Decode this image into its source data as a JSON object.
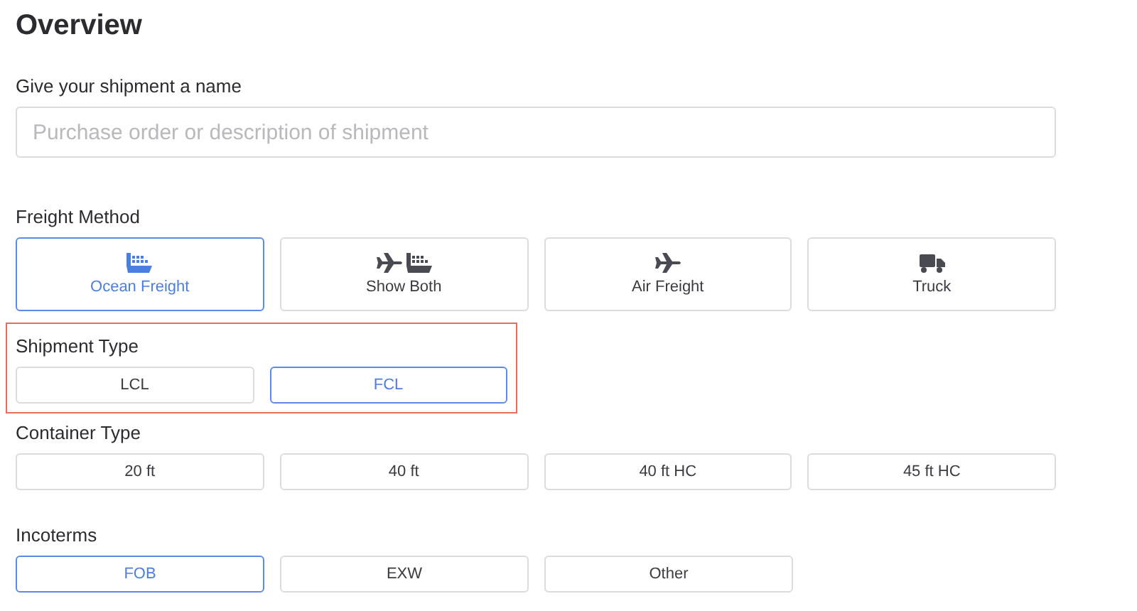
{
  "title": "Overview",
  "name_field": {
    "label": "Give your shipment a name",
    "placeholder": "Purchase order or description of shipment"
  },
  "freight_method": {
    "label": "Freight Method",
    "options": [
      {
        "label": "Ocean Freight",
        "kind": "ship",
        "selected": true
      },
      {
        "label": "Show Both",
        "kind": "both",
        "selected": false
      },
      {
        "label": "Air Freight",
        "kind": "plane",
        "selected": false
      },
      {
        "label": "Truck",
        "kind": "truck",
        "selected": false
      }
    ]
  },
  "sections": [
    {
      "label": "Shipment Type",
      "highlighted": true,
      "options": [
        {
          "label": "LCL",
          "selected": false
        },
        {
          "label": "FCL",
          "selected": true
        }
      ]
    },
    {
      "label": "Container Type",
      "highlighted": false,
      "options": [
        {
          "label": "20 ft",
          "selected": false
        },
        {
          "label": "40 ft",
          "selected": false
        },
        {
          "label": "40 ft HC",
          "selected": false
        },
        {
          "label": "45 ft HC",
          "selected": false
        }
      ]
    },
    {
      "label": "Incoterms",
      "highlighted": false,
      "options": [
        {
          "label": "FOB",
          "selected": true
        },
        {
          "label": "EXW",
          "selected": false
        },
        {
          "label": "Other",
          "selected": false
        }
      ]
    }
  ]
}
